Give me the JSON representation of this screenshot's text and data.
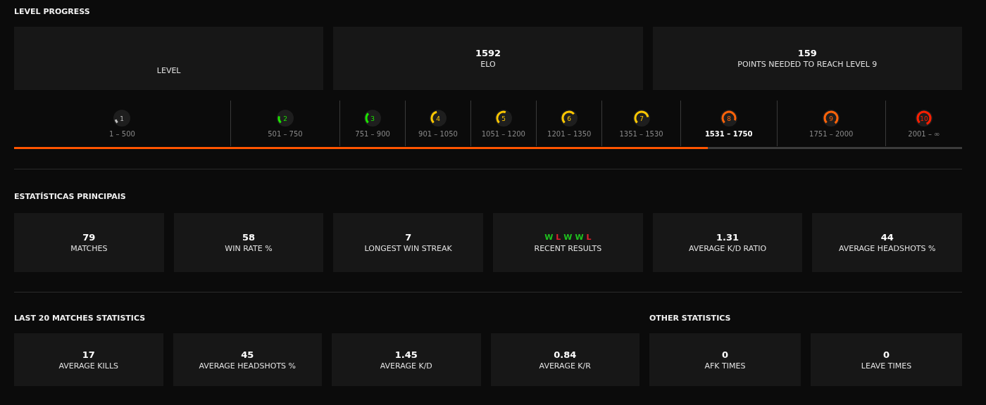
{
  "level_progress": {
    "title": "LEVEL PROGRESS",
    "cards": [
      {
        "label": "LEVEL"
      },
      {
        "value": "1592",
        "label": "ELO"
      },
      {
        "value": "159",
        "label": "POINTS NEEDED TO REACH LEVEL 9"
      }
    ],
    "levels": [
      {
        "number": "1",
        "range": "1 – 500",
        "color": "#bdbdbd",
        "selected": false
      },
      {
        "number": "2",
        "range": "501 – 750",
        "color": "#1ce400",
        "selected": false
      },
      {
        "number": "3",
        "range": "751 – 900",
        "color": "#1ce400",
        "selected": false
      },
      {
        "number": "4",
        "range": "901 – 1050",
        "color": "#ffc800",
        "selected": false
      },
      {
        "number": "5",
        "range": "1051 – 1200",
        "color": "#ffc800",
        "selected": false
      },
      {
        "number": "6",
        "range": "1201 – 1350",
        "color": "#ffc800",
        "selected": false
      },
      {
        "number": "7",
        "range": "1351 – 1530",
        "color": "#ffc800",
        "selected": false
      },
      {
        "number": "8",
        "range": "1531 – 1750",
        "color": "#ff6309",
        "selected": true
      },
      {
        "number": "9",
        "range": "1751 – 2000",
        "color": "#ff6309",
        "selected": false
      },
      {
        "number": "10",
        "range": "2001 – ∞",
        "color": "#fe1f00",
        "selected": false
      }
    ],
    "level": 0.732
  },
  "main_stats": {
    "title": "ESTATÍSTICAS PRINCIPAIS",
    "cards": [
      {
        "value": "79",
        "label": "MATCHES"
      },
      {
        "value": "58",
        "label": "WIN RATE %"
      },
      {
        "value": "7",
        "label": "LONGEST WIN STREAK"
      },
      {
        "results": [
          {
            "letter": "W",
            "kind": "win"
          },
          {
            "letter": "L",
            "kind": "loss"
          },
          {
            "letter": "W",
            "kind": "win"
          },
          {
            "letter": "W",
            "kind": "win"
          },
          {
            "letter": "L",
            "kind": "loss"
          }
        ],
        "label": "RECENT RESULTS"
      },
      {
        "value": "1.31",
        "label": "AVERAGE K/D RATIO"
      },
      {
        "value": "44",
        "label": "AVERAGE HEADSHOTS %"
      }
    ]
  },
  "last_20": {
    "title": "LAST 20 MATCHES STATISTICS",
    "cards": [
      {
        "value": "17",
        "label": "AVERAGE KILLS"
      },
      {
        "value": "45",
        "label": "AVERAGE HEADSHOTS %"
      },
      {
        "value": "1.45",
        "label": "AVERAGE K/D"
      },
      {
        "value": "0.84",
        "label": "AVERAGE K/R"
      }
    ]
  },
  "other": {
    "title": "OTHER STATISTICS",
    "cards": [
      {
        "value": "0",
        "label": "AFK TIMES"
      },
      {
        "value": "0",
        "label": "LEAVE TIMES"
      }
    ]
  }
}
